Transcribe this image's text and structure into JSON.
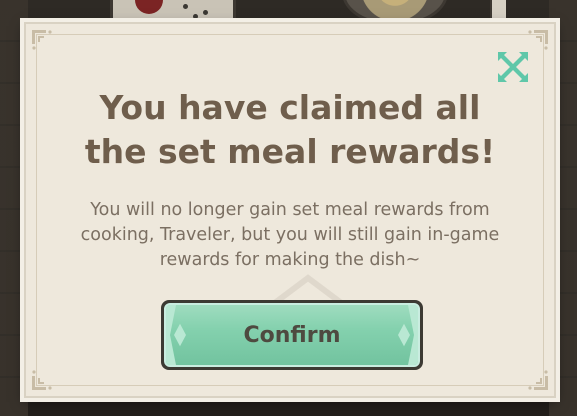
{
  "dialog": {
    "title": "You have claimed all the set meal rewards!",
    "message": "You will no longer gain set meal rewards from cooking, Traveler, but you will still gain in-game rewards for making the dish~",
    "confirm_label": "Confirm",
    "close_icon": "close-x-icon"
  },
  "colors": {
    "panel_bg": "#eee8dc",
    "title_text": "#6f5e4c",
    "body_text": "#7b6f62",
    "confirm_green": "#84d1ae",
    "close_icon_teal": "#5fc7a9"
  }
}
